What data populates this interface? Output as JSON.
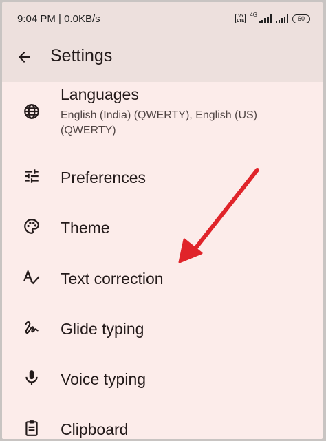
{
  "status_bar": {
    "time": "9:04 PM | 0.0KB/s",
    "volte": "Vo LTE",
    "network": "4G",
    "battery": "60"
  },
  "app_bar": {
    "title": "Settings"
  },
  "settings_items": [
    {
      "label": "Languages",
      "subtitle": "English (India) (QWERTY), English (US) (QWERTY)",
      "icon": "globe-icon"
    },
    {
      "label": "Preferences",
      "icon": "tune-icon"
    },
    {
      "label": "Theme",
      "icon": "palette-icon"
    },
    {
      "label": "Text correction",
      "icon": "spellcheck-icon"
    },
    {
      "label": "Glide typing",
      "icon": "gesture-icon"
    },
    {
      "label": "Voice typing",
      "icon": "mic-icon"
    },
    {
      "label": "Clipboard",
      "icon": "clipboard-icon"
    }
  ],
  "annotation": {
    "color": "#e0242a",
    "points_to": "Text correction"
  },
  "colors": {
    "background": "#fcecea",
    "header": "#ede0dd",
    "text": "#231a1a"
  }
}
